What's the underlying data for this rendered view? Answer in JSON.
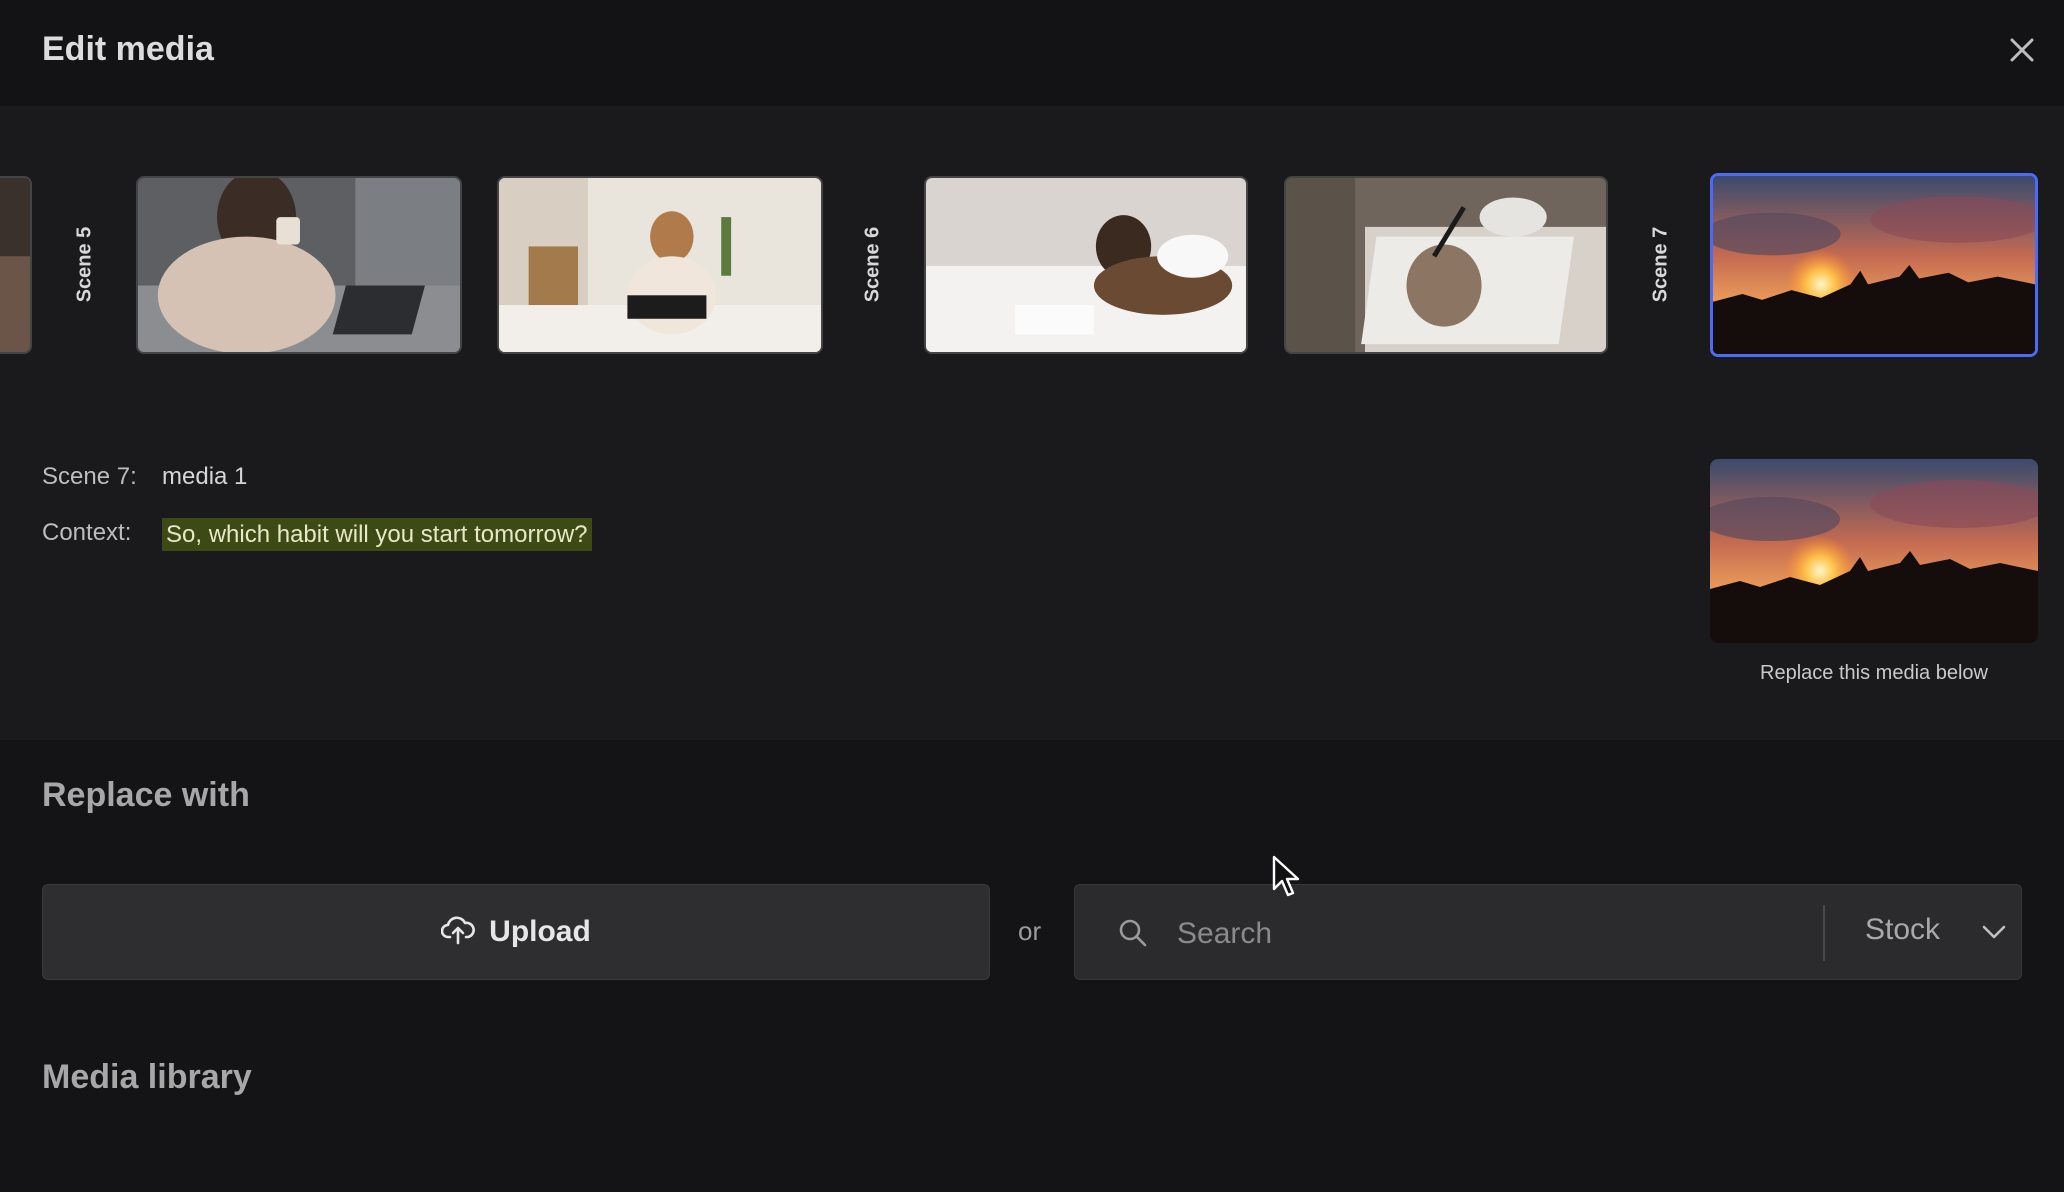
{
  "modal": {
    "title": "Edit media",
    "close_icon": "close-icon"
  },
  "timeline": {
    "scene_labels": [
      "Scene 5",
      "Scene 6",
      "Scene 7"
    ],
    "thumbnails": [
      {
        "scene": "Scene 5",
        "description": "woman in bed with laptop and mug"
      },
      {
        "scene": "Scene 5",
        "description": "girl on bed with laptop"
      },
      {
        "scene": "Scene 6",
        "description": "woman writing in bed"
      },
      {
        "scene": "Scene 6",
        "description": "hand writing in notebook with coffee cup"
      },
      {
        "scene": "Scene 7",
        "description": "sunset over city skyline",
        "selected": true
      }
    ]
  },
  "details": {
    "scene_label": "Scene 7:",
    "scene_value": "media 1",
    "context_label": "Context:",
    "context_value": "So, which habit will you start tomorrow?",
    "preview_caption": "Replace this media below"
  },
  "replace": {
    "heading": "Replace with",
    "upload_label": "Upload",
    "upload_icon": "cloud-upload-icon",
    "or_text": "or",
    "search_placeholder": "Search",
    "search_icon": "search-icon",
    "source_selected": "Stock",
    "source_icon": "chevron-down-icon"
  },
  "library": {
    "heading": "Media library"
  },
  "colors": {
    "accent": "#4a6cf7",
    "context_highlight": "#3e4a16",
    "background": "#1a1a1d"
  }
}
